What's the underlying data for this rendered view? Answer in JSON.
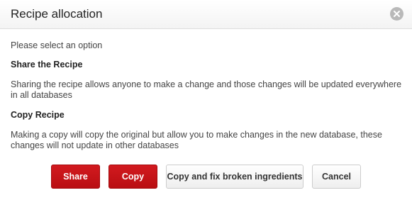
{
  "dialog": {
    "title": "Recipe allocation",
    "close_icon": "close-icon",
    "intro": "Please select an option",
    "sections": [
      {
        "heading": "Share the Recipe",
        "description": "Sharing the recipe allows anyone to make a change and those changes will be updated everywhere in all databases"
      },
      {
        "heading": "Copy Recipe",
        "description": "Making a copy will copy the original but allow you to make changes in the new database, these changes will not update in other databases"
      }
    ]
  },
  "buttons": {
    "share": "Share",
    "copy": "Copy",
    "copy_fix": "Copy and fix broken ingredients",
    "cancel": "Cancel"
  },
  "colors": {
    "primary": "#c8151a",
    "close_bg": "#b9b9b9"
  }
}
